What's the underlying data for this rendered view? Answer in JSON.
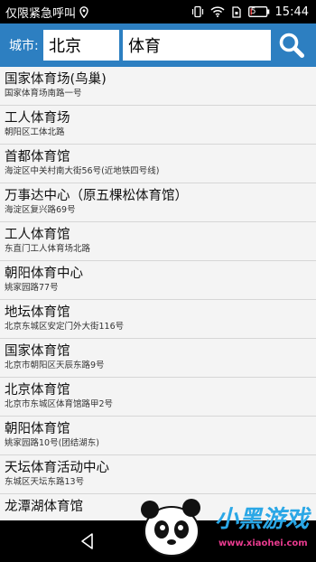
{
  "status_bar": {
    "carrier_text": "仅限紧急呼叫",
    "battery_percent": "5",
    "time": "15:44"
  },
  "search": {
    "city_label": "城市:",
    "city_value": "北京",
    "keyword_value": "体育"
  },
  "results": [
    {
      "name": "国家体育场(鸟巢)",
      "address": "国家体育场南路一号"
    },
    {
      "name": "工人体育场",
      "address": "朝阳区工体北路"
    },
    {
      "name": "首都体育馆",
      "address": "海淀区中关村南大街56号(近地铁四号线)"
    },
    {
      "name": "万事达中心（原五棵松体育馆）",
      "address": "海淀区复兴路69号"
    },
    {
      "name": "工人体育馆",
      "address": "东直门工人体育场北路"
    },
    {
      "name": "朝阳体育中心",
      "address": "姚家园路77号"
    },
    {
      "name": "地坛体育馆",
      "address": "北京东城区安定门外大街116号"
    },
    {
      "name": "国家体育馆",
      "address": "北京市朝阳区天辰东路9号"
    },
    {
      "name": "北京体育馆",
      "address": "北京市东城区体育馆路甲2号"
    },
    {
      "name": "朝阳体育馆",
      "address": "姚家园路10号(团结湖东)"
    },
    {
      "name": "天坛体育活动中心",
      "address": "东城区天坛东路13号"
    },
    {
      "name": "龙潭湖体育馆",
      "address": ""
    }
  ],
  "watermark": {
    "brand": "小黑游戏",
    "site": "www.xiaohei.com"
  },
  "colors": {
    "header_bg": "#2d7fc1",
    "status_bg": "#000000"
  }
}
